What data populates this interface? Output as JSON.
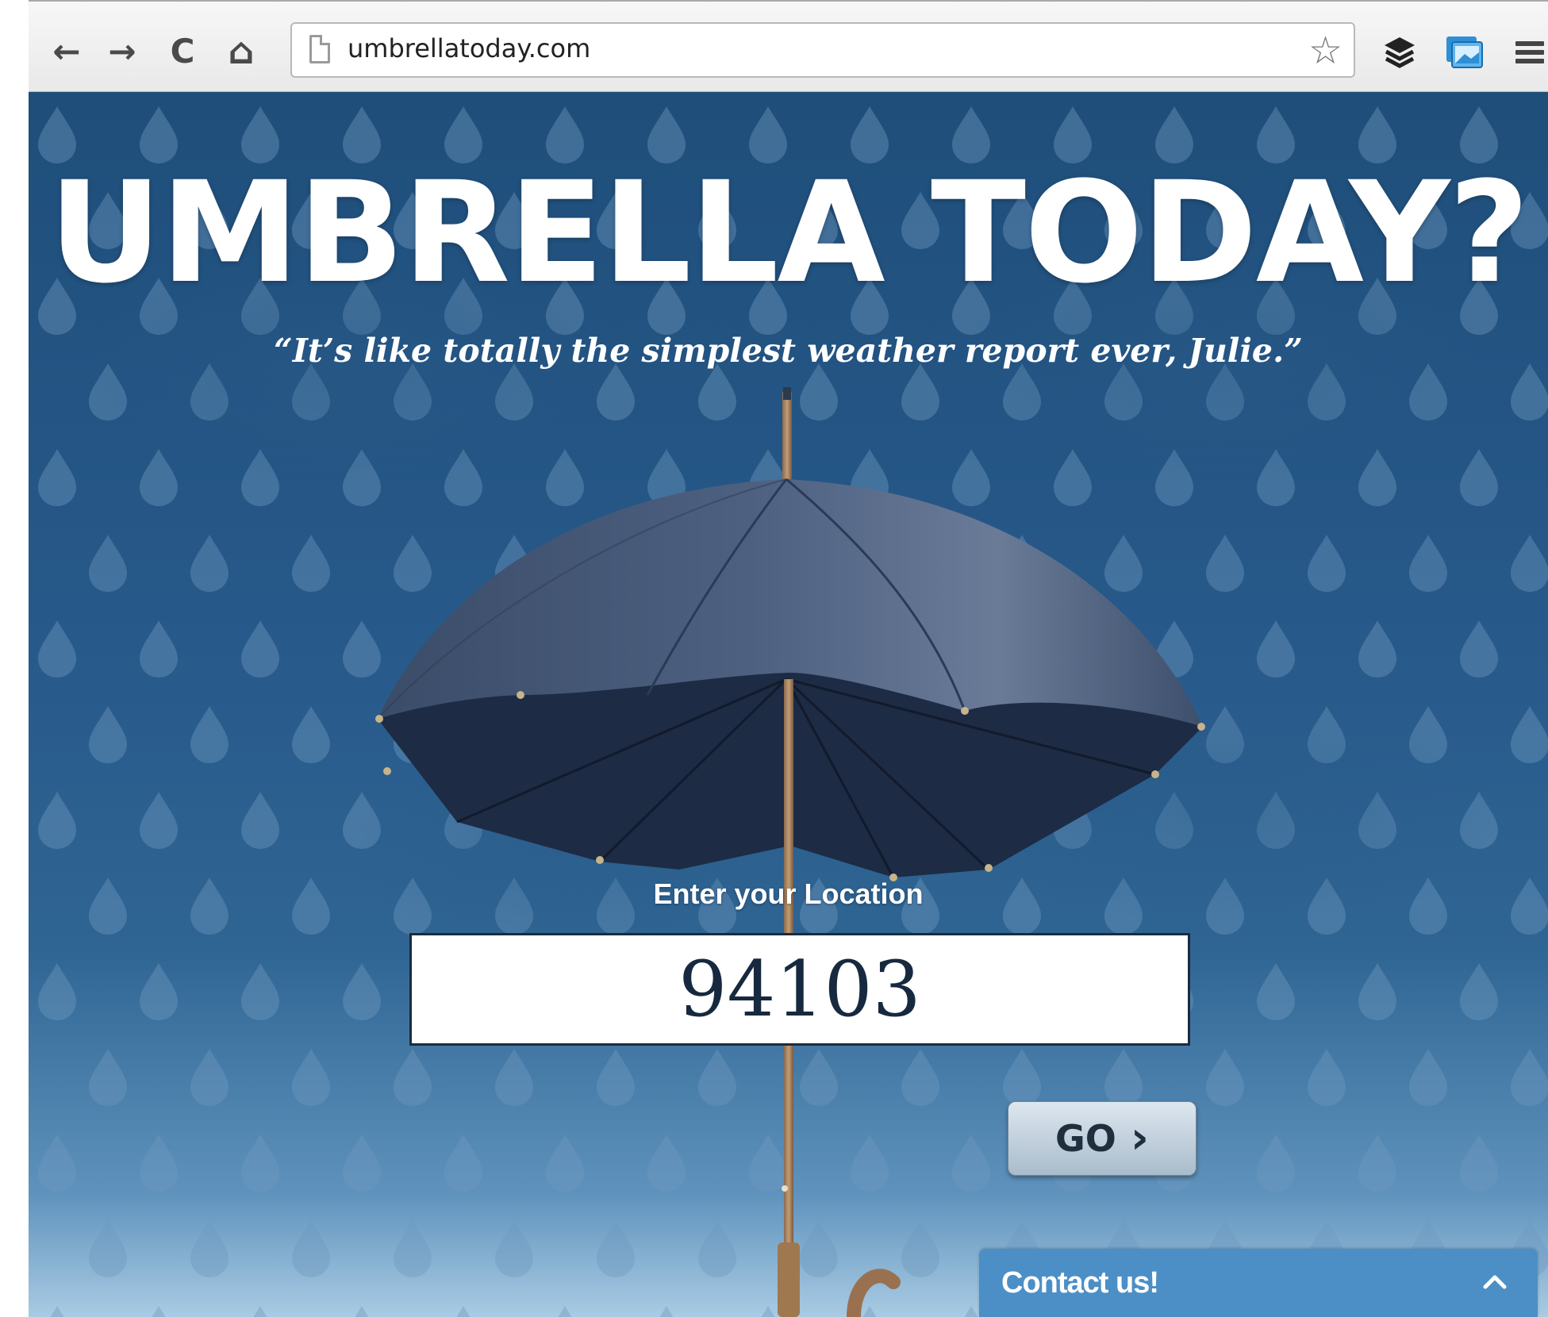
{
  "browser": {
    "url": "umbrellatoday.com",
    "nav": {
      "back_icon": "back-arrow-icon",
      "forward_icon": "forward-arrow-icon",
      "reload_icon": "reload-icon",
      "home_icon": "home-icon"
    },
    "back_glyph": "←",
    "forward_glyph": "→",
    "reload_glyph": "C",
    "home_glyph": "⌂",
    "star_glyph": "☆"
  },
  "page": {
    "title": "UMBRELLA TODAY?",
    "tagline": "“It’s like totally the simplest weather report ever, Julie.”",
    "location_label": "Enter your Location",
    "location_value": "94103",
    "go_label": "GO",
    "go_glyph": "›",
    "contact_label": "Contact us!"
  },
  "colors": {
    "background_top": "#1f4e7a",
    "background_bottom": "#a9cbe3",
    "contact_bar": "#4c8fc7",
    "title_text": "#ffffff"
  }
}
